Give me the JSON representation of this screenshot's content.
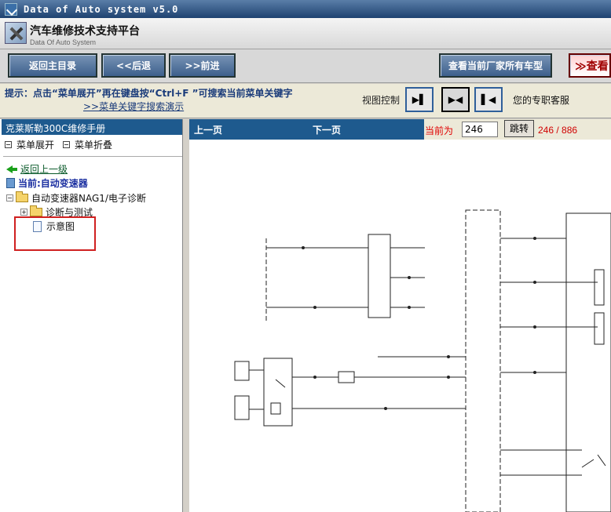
{
  "window": {
    "title": "Data of Auto system v5.0"
  },
  "header": {
    "title": "汽车维修技术支持平台",
    "subtitle": "Data Of Auto System"
  },
  "nav": {
    "home": "返回主目录",
    "back": "<<后退",
    "forward": ">>前进",
    "view_all_models": "查看当前厂家所有车型",
    "more": "≫查看"
  },
  "hint": {
    "text": "提示：点击“菜单展开”再在键盘按“Ctrl+F ”可搜索当前菜单关键字",
    "link": ">>菜单关键字搜索演示"
  },
  "view_control": {
    "label": "视图控制",
    "buttons": [
      "▶▌",
      "▶◀",
      "▌◀"
    ]
  },
  "service": "您的专职客服",
  "sidebar": {
    "manual_title": "克莱斯勒300C维修手册",
    "expand": "菜单展开",
    "collapse": "菜单折叠",
    "back_up": "返回上一级",
    "current": "当前:自动变速器",
    "tree": [
      {
        "label": "自动变速器NAG1/电子诊断"
      },
      {
        "label": "诊断与测试"
      },
      {
        "label": "示意图"
      }
    ]
  },
  "pager": {
    "prev": "上一页",
    "next": "下一页",
    "current_label": "当前为",
    "current_value": "246",
    "go": "跳转",
    "count": "246 / 886"
  },
  "colors": {
    "accent": "#1e5a8e",
    "highlight": "#d02020"
  }
}
